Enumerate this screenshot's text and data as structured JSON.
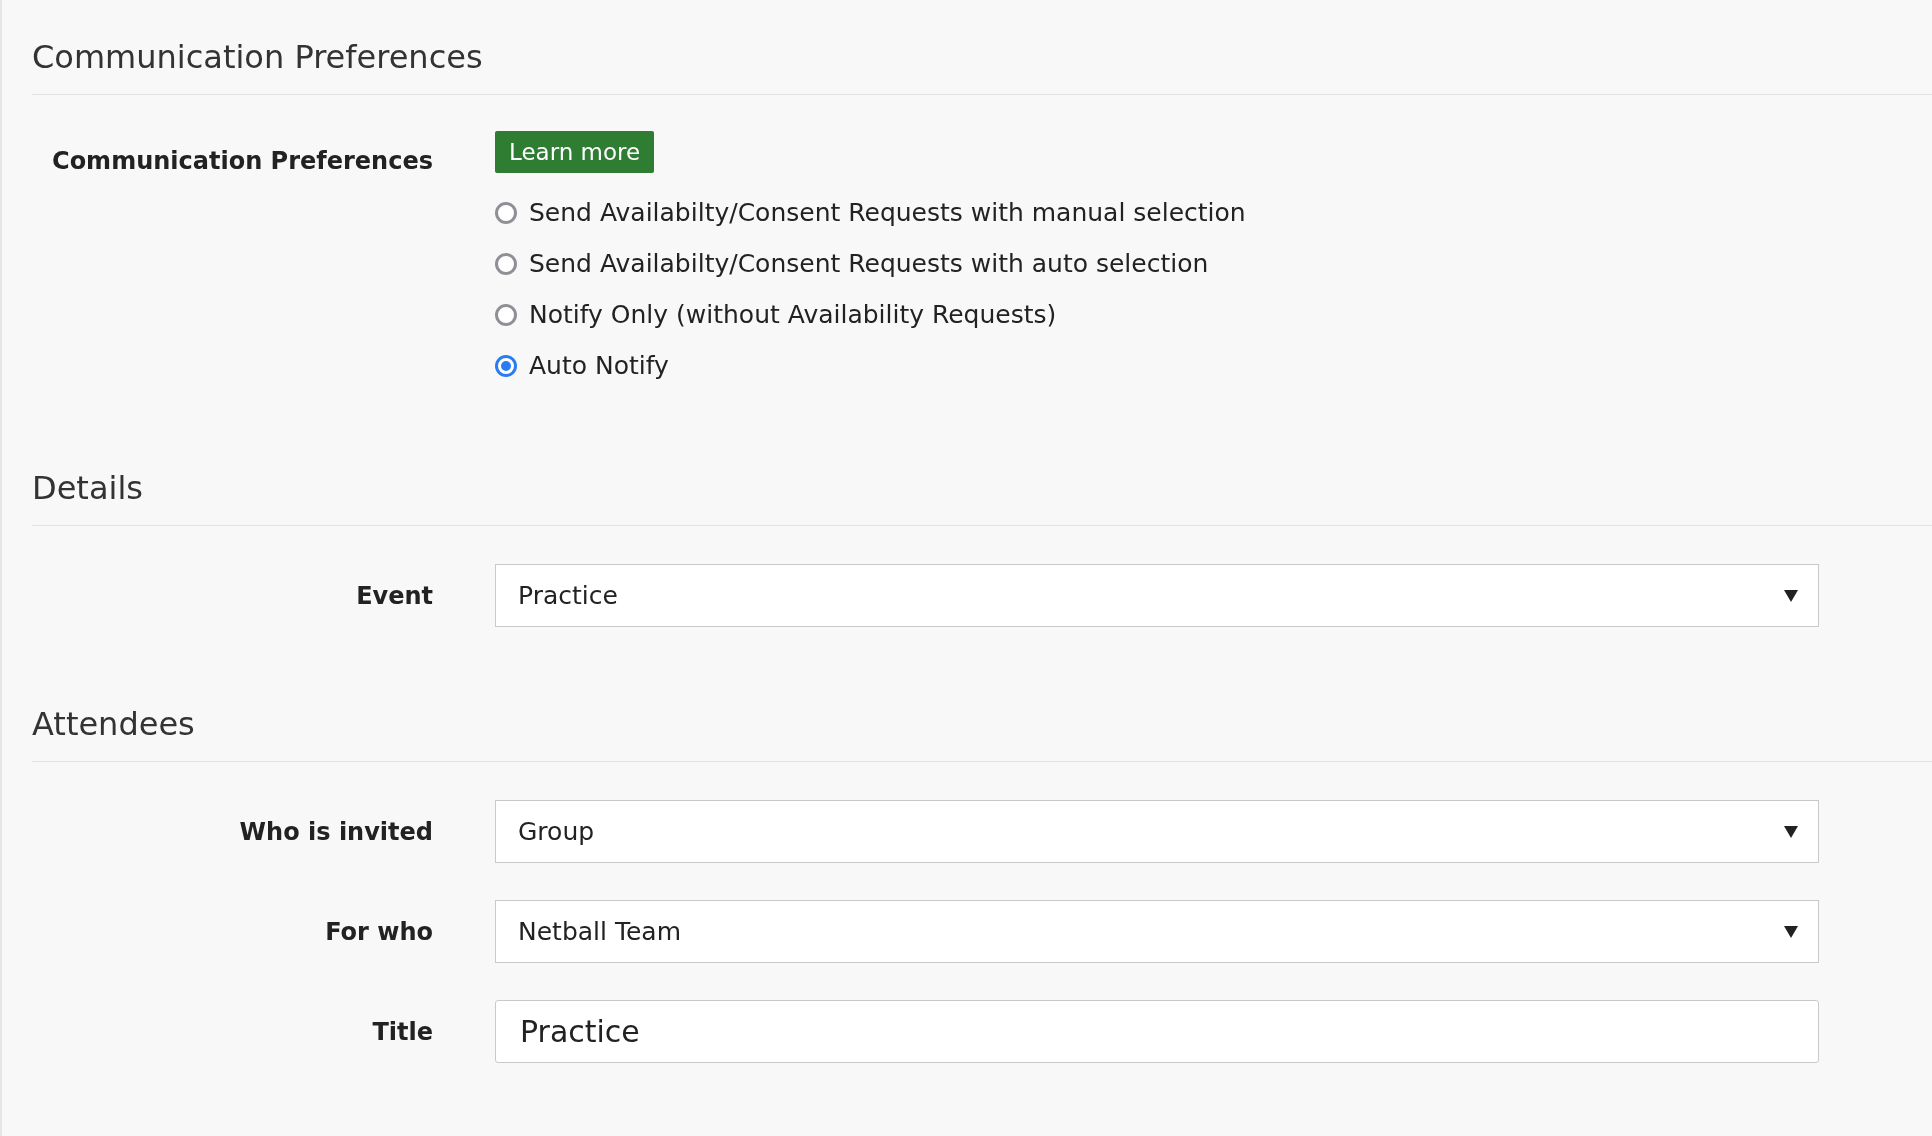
{
  "sections": [
    {
      "kind": "preferences",
      "heading": "Communication Preferences",
      "label": "Communication Preferences",
      "button": "Learn more",
      "options": [
        {
          "label": "Send Availabilty/Consent Requests with manual selection",
          "selected": false
        },
        {
          "label": "Send Availabilty/Consent Requests with auto selection",
          "selected": false
        },
        {
          "label": "Notify Only (without Availability Requests)",
          "selected": false
        },
        {
          "label": "Auto Notify",
          "selected": true
        }
      ]
    },
    {
      "kind": "fields",
      "heading": "Details",
      "fields": [
        {
          "kind": "select",
          "label": "Event",
          "value": "Practice"
        }
      ]
    },
    {
      "kind": "fields",
      "heading": "Attendees",
      "fields": [
        {
          "kind": "select",
          "label": "Who is invited",
          "value": "Group"
        },
        {
          "kind": "select",
          "label": "For who",
          "value": "Netball Team"
        },
        {
          "kind": "text",
          "label": "Title",
          "value": "Practice"
        }
      ]
    }
  ]
}
